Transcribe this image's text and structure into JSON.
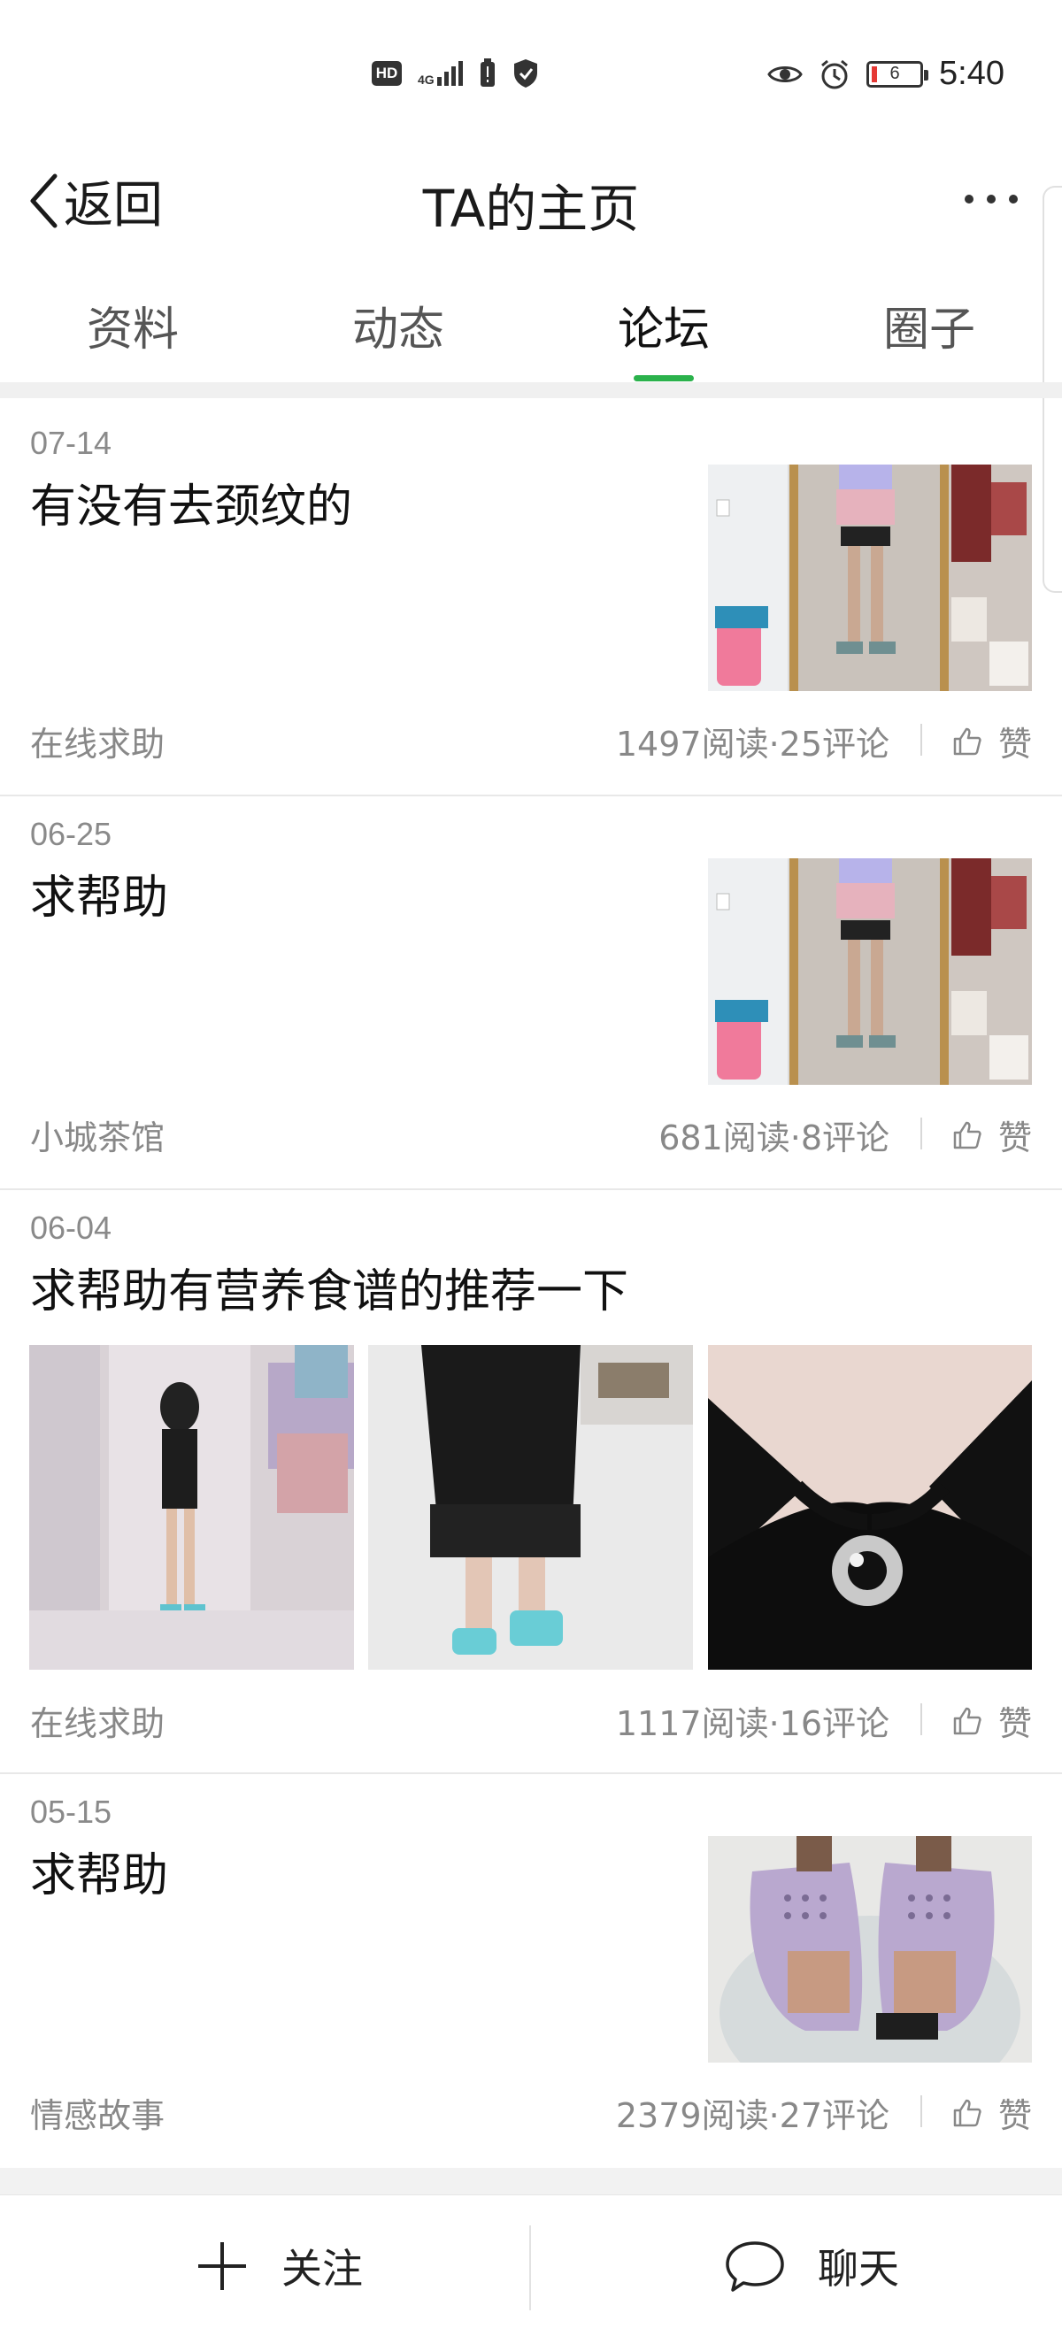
{
  "status_bar": {
    "hd": "HD",
    "network": "4G",
    "battery": "6",
    "time": "5:40"
  },
  "header": {
    "back_label": "返回",
    "title": "TA的主页"
  },
  "tabs": [
    {
      "label": "资料"
    },
    {
      "label": "动态"
    },
    {
      "label": "论坛"
    },
    {
      "label": "圈子"
    }
  ],
  "active_tab": "论坛",
  "posts": [
    {
      "date": "07-14",
      "title": "有没有去颈纹的",
      "category": "在线求助",
      "stats": "1497阅读·25评论",
      "like": "赞"
    },
    {
      "date": "06-25",
      "title": "求帮助",
      "category": "小城茶馆",
      "stats": "681阅读·8评论",
      "like": "赞"
    },
    {
      "date": "06-04",
      "title": "求帮助有营养食谱的推荐一下",
      "category": "在线求助",
      "stats": "1117阅读·16评论",
      "like": "赞"
    },
    {
      "date": "05-15",
      "title": "求帮助",
      "category": "情感故事",
      "stats": "2379阅读·27评论",
      "like": "赞"
    }
  ],
  "bottom_bar": {
    "follow_label": "关注",
    "chat_label": "聊天"
  },
  "colors": {
    "accent": "#2bb24c",
    "muted_text": "#888888",
    "separator": "#f0f0f0"
  }
}
